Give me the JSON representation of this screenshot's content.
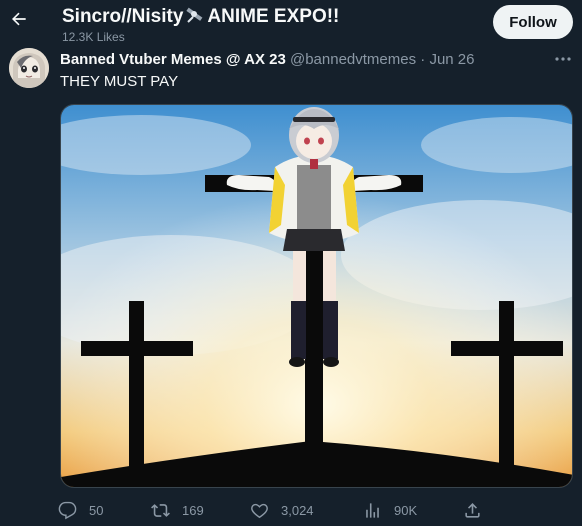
{
  "header": {
    "title_before": "Sincro//Nisity",
    "title_after": "ANIME EXPO!!",
    "subtitle": "12.3K Likes",
    "back_icon": "arrow-left-icon",
    "follow_label": "Follow"
  },
  "tweet": {
    "author_name": "Banned Vtuber Memes @ AX 23",
    "handle": "@bannedvtmemes",
    "separator": "·",
    "date": "Jun 26",
    "text": "THEY MUST PAY",
    "more_icon": "more-horizontal-icon"
  },
  "actions": {
    "replies": "50",
    "retweets": "169",
    "likes": "3,024",
    "views": "90K"
  },
  "colors": {
    "background": "#15202b",
    "text_primary": "#f7f9f9",
    "text_secondary": "#8b98a5",
    "follow_bg": "#eff3f4"
  }
}
